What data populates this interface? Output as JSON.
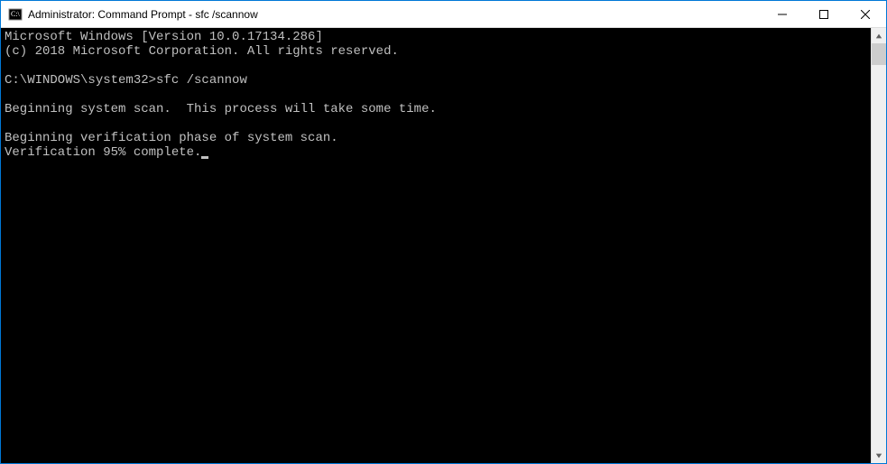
{
  "window": {
    "title": "Administrator: Command Prompt - sfc  /scannow"
  },
  "console": {
    "lines": [
      "Microsoft Windows [Version 10.0.17134.286]",
      "(c) 2018 Microsoft Corporation. All rights reserved.",
      "",
      "C:\\WINDOWS\\system32>sfc /scannow",
      "",
      "Beginning system scan.  This process will take some time.",
      "",
      "Beginning verification phase of system scan.",
      "Verification 95% complete."
    ],
    "cursor_after_last": true
  }
}
